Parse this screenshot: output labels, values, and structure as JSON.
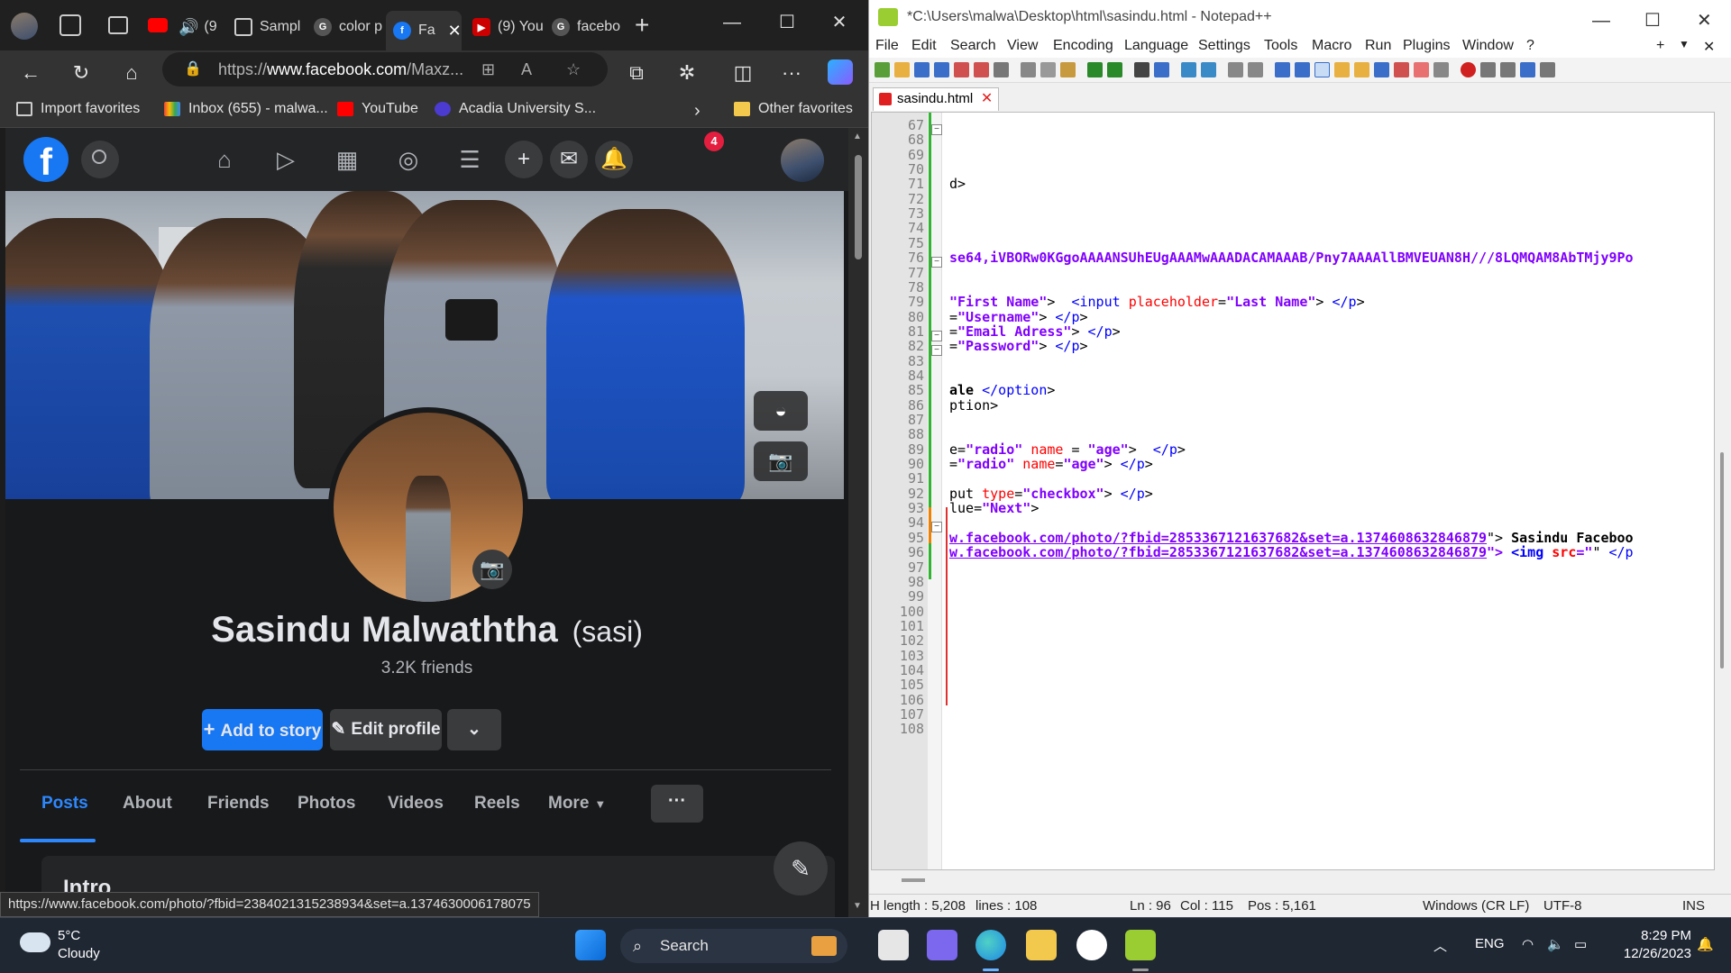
{
  "browser": {
    "tabs": [
      {
        "label": "(9",
        "icon": "speaker-icon"
      },
      {
        "label": "Sampl",
        "icon": "document-icon"
      },
      {
        "label": "color p",
        "icon": "google-icon"
      },
      {
        "label": "Fa",
        "icon": "facebook-icon",
        "active": true
      },
      {
        "label": "(9) You",
        "icon": "youtube-icon"
      },
      {
        "label": "facebo",
        "icon": "google-icon"
      }
    ],
    "url_prefix": "https://",
    "url_domain": "www.facebook.com",
    "url_rest": "/Maxz...",
    "bookmarks": {
      "import": "Import favorites",
      "inbox": "Inbox (655) - malwa...",
      "youtube": "YouTube",
      "acadia": "Acadia University S...",
      "other": "Other favorites"
    },
    "status_url": "https://www.facebook.com/photo/?fbid=2384021315238934&set=a.1374630006178075"
  },
  "facebook": {
    "messenger_badge": "4",
    "profile_name": "Sasindu Malwaththa",
    "nickname": "(sasi)",
    "friends": "3.2K friends",
    "add_story": "Add to story",
    "edit_profile": "Edit profile",
    "tabs": [
      "Posts",
      "About",
      "Friends",
      "Photos",
      "Videos",
      "Reels",
      "More"
    ],
    "more_dots": "···",
    "intro_title": "Intro"
  },
  "notepad": {
    "title": "*C:\\Users\\malwa\\Desktop\\html\\sasindu.html - Notepad++",
    "menu": [
      "File",
      "Edit",
      "Search",
      "View",
      "Encoding",
      "Language",
      "Settings",
      "Tools",
      "Macro",
      "Run",
      "Plugins",
      "Window",
      "?"
    ],
    "file_tab": "sasindu.html",
    "lines": [
      {
        "n": "67",
        "code": ""
      },
      {
        "n": "68",
        "code": ""
      },
      {
        "n": "69",
        "code": ""
      },
      {
        "n": "70",
        "code": ""
      },
      {
        "n": "71",
        "code": "d>"
      },
      {
        "n": "72",
        "code": ""
      },
      {
        "n": "73",
        "code": ""
      },
      {
        "n": "74",
        "code": ""
      },
      {
        "n": "75",
        "code": ""
      },
      {
        "n": "76",
        "code": "se64,iVBORw0KGgoAAAANSUhEUgAAAMwAAADACAMAAAB/Pny7AAAAllBMVEUAN8H///8LQMQAM8AbTMjy9Po"
      },
      {
        "n": "77",
        "code": ""
      },
      {
        "n": "78",
        "code": ""
      },
      {
        "n": "79",
        "code": "\"First Name\">  <input placeholder=\"Last Name\"> </p>"
      },
      {
        "n": "80",
        "code": "=\"Username\"> </p>"
      },
      {
        "n": "81",
        "code": "=\"Email Adress\"> </p>"
      },
      {
        "n": "82",
        "code": "=\"Password\"> </p>"
      },
      {
        "n": "83",
        "code": ""
      },
      {
        "n": "84",
        "code": ""
      },
      {
        "n": "85",
        "code": "ale </option>"
      },
      {
        "n": "86",
        "code": "ption>"
      },
      {
        "n": "87",
        "code": ""
      },
      {
        "n": "88",
        "code": ""
      },
      {
        "n": "89",
        "code": "e=\"radio\" name = \"age\">  </p>"
      },
      {
        "n": "90",
        "code": "=\"radio\" name=\"age\"> </p>"
      },
      {
        "n": "91",
        "code": ""
      },
      {
        "n": "92",
        "code": "put type=\"checkbox\"> </p>"
      },
      {
        "n": "93",
        "code": "lue=\"Next\">"
      },
      {
        "n": "94",
        "code": ""
      },
      {
        "n": "95",
        "code": "w.facebook.com/photo/?fbid=2853367121637682&set=a.1374608632846879\"> Sasindu Faceboo"
      },
      {
        "n": "96",
        "code": "w.facebook.com/photo/?fbid=2853367121637682&set=a.1374608632846879\"> <img src=\"\" </p"
      },
      {
        "n": "97",
        "code": ""
      },
      {
        "n": "98",
        "code": ""
      },
      {
        "n": "99",
        "code": ""
      },
      {
        "n": "100",
        "code": ""
      },
      {
        "n": "101",
        "code": ""
      },
      {
        "n": "102",
        "code": ""
      },
      {
        "n": "103",
        "code": ""
      },
      {
        "n": "104",
        "code": ""
      },
      {
        "n": "105",
        "code": ""
      },
      {
        "n": "106",
        "code": ""
      },
      {
        "n": "107",
        "code": ""
      },
      {
        "n": "108",
        "code": ""
      }
    ],
    "status": {
      "length": "H length : 5,208",
      "lines": "lines : 108",
      "ln": "Ln : 96",
      "col": "Col : 115",
      "pos": "Pos : 5,161",
      "eol": "Windows (CR LF)",
      "encoding": "UTF-8",
      "mode": "INS"
    }
  },
  "taskbar": {
    "temp": "5°C",
    "condition": "Cloudy",
    "search": "Search",
    "lang": "ENG",
    "time": "8:29 PM",
    "date": "12/26/2023"
  },
  "colors": {
    "fb_blue": "#1877f2",
    "fb_bg": "#18191a",
    "npp_string": "#8000ff",
    "npp_attr": "#ff0000"
  }
}
